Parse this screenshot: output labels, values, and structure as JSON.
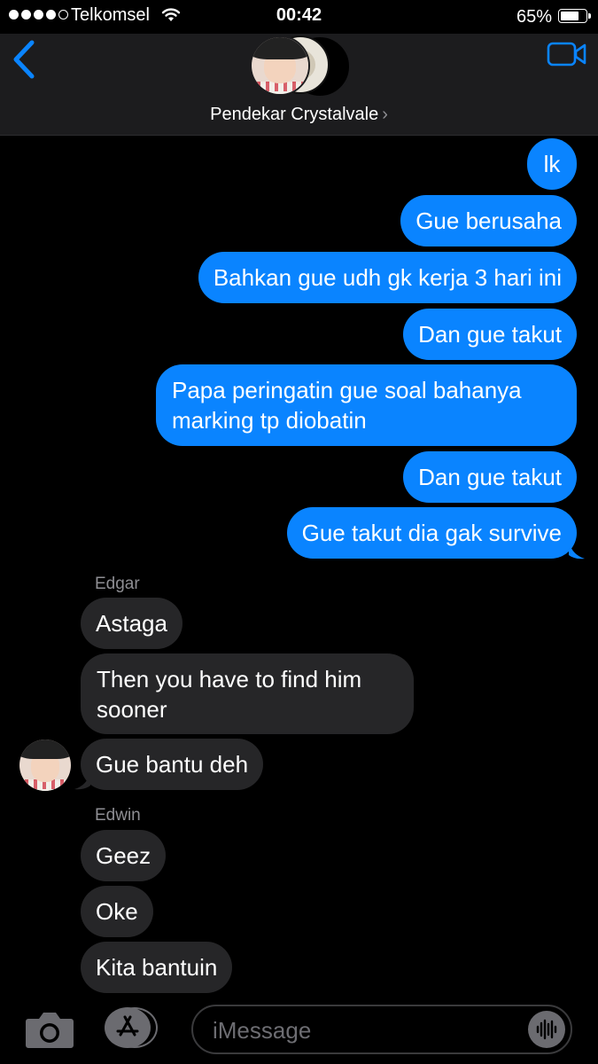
{
  "status_bar": {
    "carrier": "Telkomsel",
    "time": "00:42",
    "battery_percent": "65%",
    "signal_bars_filled": 4,
    "signal_bars_total": 5,
    "battery_level": 0.65
  },
  "header": {
    "contact_name": "Pendekar Crystalvale",
    "chevron": "›",
    "accent_color": "#0a84ff"
  },
  "messages": [
    {
      "direction": "out",
      "text": "lk"
    },
    {
      "direction": "out",
      "text": "Gue berusaha"
    },
    {
      "direction": "out",
      "text": "Bahkan gue udh gk kerja 3 hari ini"
    },
    {
      "direction": "out",
      "text": "Dan gue takut"
    },
    {
      "direction": "out",
      "text": "Papa peringatin gue soal bahanya marking tp diobatin"
    },
    {
      "direction": "out",
      "text": "Dan gue takut"
    },
    {
      "direction": "out",
      "text": "Gue takut dia gak survive"
    },
    {
      "direction": "in",
      "sender": "Edgar",
      "text": "Astaga"
    },
    {
      "direction": "in",
      "text": "Then you have to find him sooner"
    },
    {
      "direction": "in",
      "text": "Gue bantu deh"
    },
    {
      "direction": "in",
      "sender": "Edwin",
      "text": "Geez"
    },
    {
      "direction": "in",
      "text": "Oke"
    },
    {
      "direction": "in",
      "text": "Kita bantuin"
    }
  ],
  "composer": {
    "placeholder": "iMessage"
  },
  "icons": {
    "back": "chevron-left-icon",
    "video": "video-camera-icon",
    "camera": "camera-icon",
    "app_store": "app-store-icon",
    "audio": "audio-waveform-icon"
  }
}
